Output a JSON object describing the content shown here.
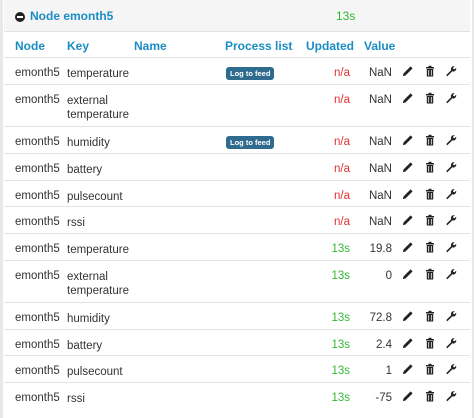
{
  "node": {
    "title": "Node emonth5",
    "updated": "13s"
  },
  "columns": {
    "node": "Node",
    "key": "Key",
    "name": "Name",
    "process": "Process list",
    "updated": "Updated",
    "value": "Value"
  },
  "rows": [
    {
      "node": "emonth5",
      "key": "temperature",
      "process": "Log to feed",
      "updated": "n/a",
      "value": "NaN",
      "status": "na"
    },
    {
      "node": "emonth5",
      "key": "external\ntemperature",
      "process": "",
      "updated": "n/a",
      "value": "NaN",
      "status": "na"
    },
    {
      "node": "emonth5",
      "key": "humidity",
      "process": "Log to feed",
      "updated": "n/a",
      "value": "NaN",
      "status": "na"
    },
    {
      "node": "emonth5",
      "key": "battery",
      "process": "",
      "updated": "n/a",
      "value": "NaN",
      "status": "na"
    },
    {
      "node": "emonth5",
      "key": "pulsecount",
      "process": "",
      "updated": "n/a",
      "value": "NaN",
      "status": "na"
    },
    {
      "node": "emonth5",
      "key": "rssi",
      "process": "",
      "updated": "n/a",
      "value": "NaN",
      "status": "na"
    },
    {
      "node": "emonth5",
      "key": "temperature",
      "process": "",
      "updated": "13s",
      "value": "19.8",
      "status": "ok"
    },
    {
      "node": "emonth5",
      "key": "external\ntemperature",
      "process": "",
      "updated": "13s",
      "value": "0",
      "status": "ok"
    },
    {
      "node": "emonth5",
      "key": "humidity",
      "process": "",
      "updated": "13s",
      "value": "72.8",
      "status": "ok"
    },
    {
      "node": "emonth5",
      "key": "battery",
      "process": "",
      "updated": "13s",
      "value": "2.4",
      "status": "ok"
    },
    {
      "node": "emonth5",
      "key": "pulsecount",
      "process": "",
      "updated": "13s",
      "value": "1",
      "status": "ok"
    },
    {
      "node": "emonth5",
      "key": "rssi",
      "process": "",
      "updated": "13s",
      "value": "-75",
      "status": "ok"
    }
  ],
  "icons": {
    "edit": "pencil-icon",
    "delete": "trash-icon",
    "config": "wrench-icon",
    "collapse": "minus-circle-icon"
  },
  "colors": {
    "accent": "#1a8dc4",
    "ok": "#33b833",
    "na": "#e03030",
    "tag": "#2e6b8f"
  }
}
